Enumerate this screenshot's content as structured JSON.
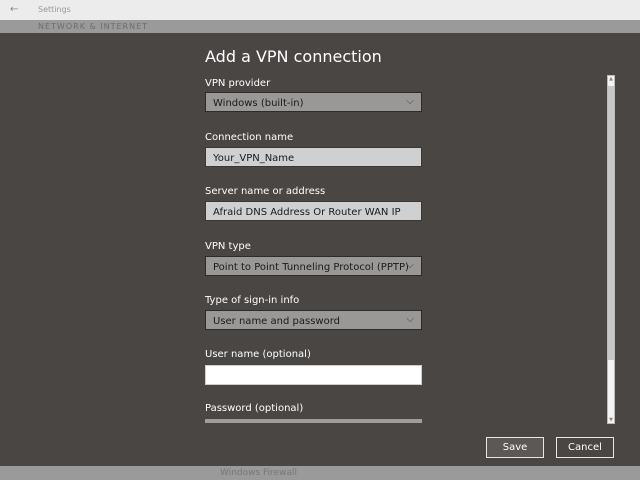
{
  "window": {
    "back_icon": "arrow-left-icon",
    "title": "Settings",
    "section": "NETWORK & INTERNET",
    "behind_item": "Windows Firewall"
  },
  "dialog": {
    "title": "Add a VPN connection",
    "fields": [
      {
        "label": "VPN provider",
        "value": "Windows (built-in)",
        "type": "select"
      },
      {
        "label": "Connection name",
        "value": "Your_VPN_Name",
        "type": "text"
      },
      {
        "label": "Server name or address",
        "value": "Afraid DNS Address Or Router WAN IP",
        "type": "text"
      },
      {
        "label": "VPN type",
        "value": "Point to Point Tunneling Protocol (PPTP)",
        "type": "select"
      },
      {
        "label": "Type of sign-in info",
        "value": "User name and password",
        "type": "select"
      },
      {
        "label": "User name (optional)",
        "value": "",
        "type": "text"
      },
      {
        "label": "Password (optional)",
        "value": "",
        "type": "password"
      }
    ],
    "chevron": "⌵",
    "save_label": "Save",
    "cancel_label": "Cancel"
  }
}
